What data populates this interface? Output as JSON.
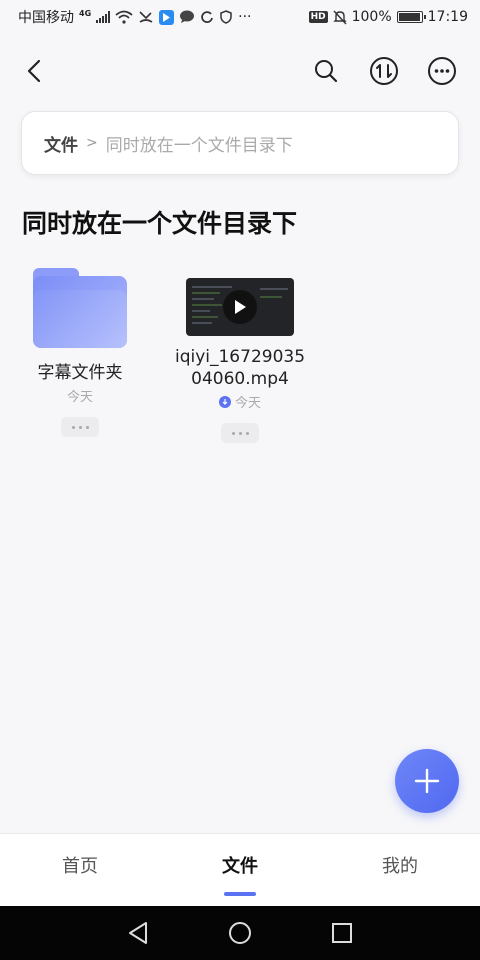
{
  "status_bar": {
    "carrier": "中国移动",
    "network": "4G",
    "battery": "100%",
    "battery_level": 1.0,
    "time": "17:19",
    "hd": "HD"
  },
  "toolbar": {
    "back_icon": "chevron-left-icon",
    "search_icon": "search-icon",
    "sort_icon": "sort-icon",
    "more_icon": "more-icon"
  },
  "breadcrumb": {
    "root": "文件",
    "separator": ">",
    "current": "同时放在一个文件目录下"
  },
  "page_title": "同时放在一个文件目录下",
  "files": [
    {
      "type": "folder",
      "name": "字幕文件夹",
      "date": "今天"
    },
    {
      "type": "video",
      "name_line1": "iqiyi_16729035",
      "name_line2": "04060.mp4",
      "date": "今天",
      "downloaded": true
    }
  ],
  "fab": {
    "icon": "plus-icon"
  },
  "bottom_nav": {
    "items": [
      {
        "label": "首页",
        "active": false
      },
      {
        "label": "文件",
        "active": true
      },
      {
        "label": "我的",
        "active": false
      }
    ]
  },
  "colors": {
    "accent": "#5b72f2",
    "folder": "#8d9cf8",
    "background": "#f7f7f9"
  }
}
